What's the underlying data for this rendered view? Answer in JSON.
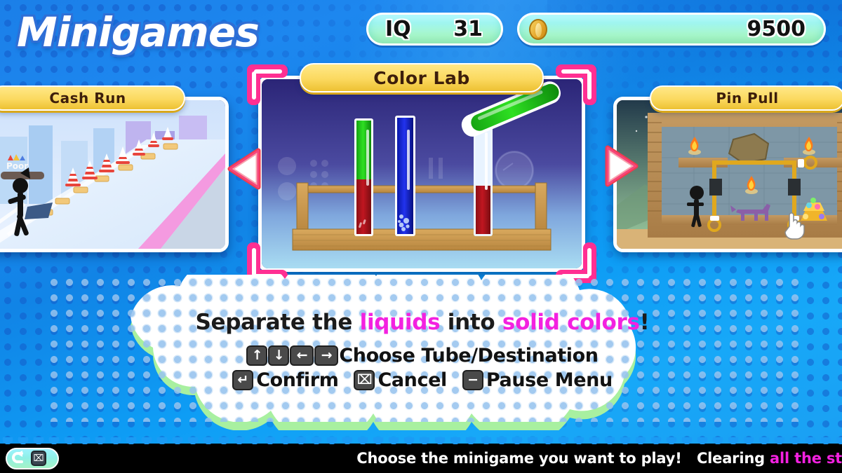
{
  "header": {
    "title": "Minigames",
    "stats": {
      "iq_label": "IQ",
      "iq_value": "31",
      "coin_icon": "coin-icon",
      "coin_value": "9500"
    }
  },
  "carousel": {
    "prev_icon": "triangle-left-icon",
    "next_icon": "triangle-right-icon",
    "panels": [
      {
        "id": "cash-run",
        "title": "Cash Run",
        "position": "left",
        "selected": false,
        "scene_label": "Poor"
      },
      {
        "id": "color-lab",
        "title": "Color Lab",
        "position": "center",
        "selected": true,
        "scene_label": ""
      },
      {
        "id": "pin-pull",
        "title": "Pin Pull",
        "position": "right",
        "selected": false,
        "scene_label": ""
      }
    ]
  },
  "info_cloud": {
    "headline": {
      "part1": "Separate the ",
      "highlight1": "liquids",
      "part2": " into ",
      "highlight2": "solid colors",
      "part3": "!"
    },
    "controls": [
      {
        "keys": [
          "arrow-up-icon",
          "arrow-down-icon",
          "arrow-left-icon",
          "arrow-right-icon"
        ],
        "glyphs": [
          "↑",
          "↓",
          "←",
          "→"
        ],
        "label": "Choose Tube/Destination"
      },
      {
        "keys": [
          "enter-key-icon"
        ],
        "glyphs": [
          "↵"
        ],
        "label": "Confirm"
      },
      {
        "keys": [
          "x-key-icon"
        ],
        "glyphs": [
          "⌧"
        ],
        "label": "Cancel"
      },
      {
        "keys": [
          "minus-key-icon"
        ],
        "glyphs": [
          "−"
        ],
        "label": "Pause Menu"
      }
    ]
  },
  "bottom_bar": {
    "back_icon": "back-arrow-icon",
    "back_key_icon": "x-key-icon",
    "back_key_glyph": "⌧",
    "ticker": {
      "part1": "Choose the minigame you want to play!",
      "part2": "Clearing ",
      "highlight": "all the st"
    }
  },
  "colors": {
    "background_blue": "#1187ea",
    "halftone_dot": "#1456c8",
    "title_white": "#ffffff",
    "title_outline": "#2f6fd6",
    "pill_gradient_start": "#b8fbff",
    "pill_gradient_end": "#b6f6b2",
    "panel_title_yellow": "#fbd95f",
    "panel_title_text": "#3d1e0b",
    "corner_pink": "#ff2f92",
    "arrow_red": "#ef3b4e",
    "cloud_white": "#ffffff",
    "cloud_shadow_green": "#a8f0a0",
    "highlight_magenta": "#f321e0",
    "key_gray": "#4a4a4a",
    "bottom_bar_black": "#000000"
  }
}
